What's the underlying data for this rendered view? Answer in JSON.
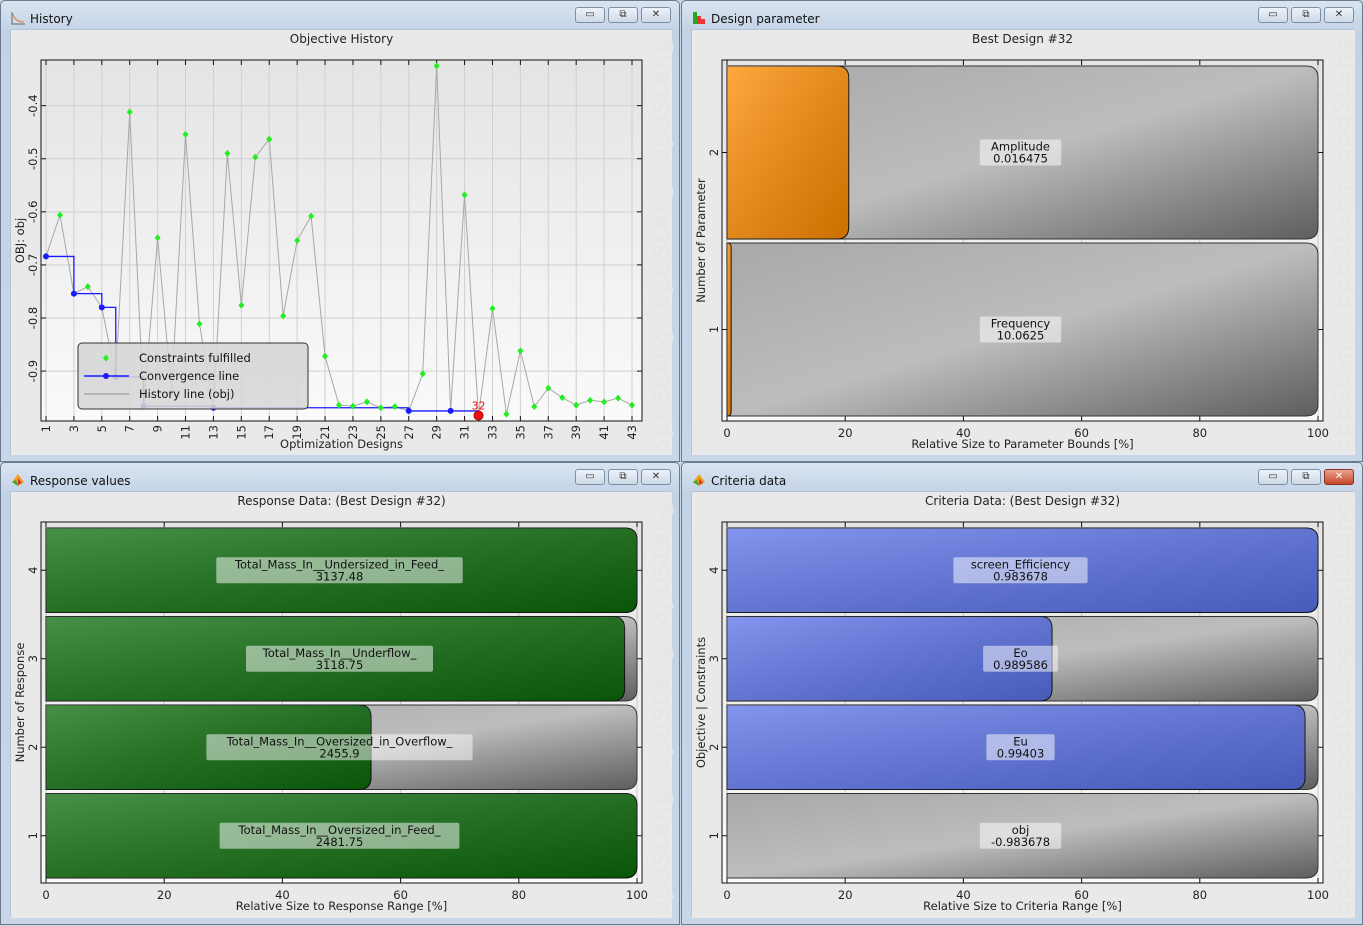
{
  "windows": {
    "history": {
      "title": "History",
      "icon": "history-chart-icon",
      "buttons": {
        "minimize": "▭",
        "restore": "⧉",
        "close": "✕"
      }
    },
    "design": {
      "title": "Design parameter",
      "icon": "bar-chart-icon",
      "buttons": {
        "minimize": "▭",
        "restore": "⧉",
        "close": "✕"
      }
    },
    "response": {
      "title": "Response values",
      "icon": "optislang-icon",
      "buttons": {
        "minimize": "▭",
        "restore": "⧉",
        "close": "✕"
      }
    },
    "criteria": {
      "title": "Criteria data",
      "icon": "optislang-icon",
      "buttons": {
        "minimize": "▭",
        "restore": "⧉",
        "close": "✕"
      }
    }
  },
  "watermark": "optiSLang",
  "chart_data": [
    {
      "type": "line",
      "title": "Objective History",
      "xlabel": "Optimization Designs",
      "ylabel": "OBJ: obj",
      "xlim": [
        0.6,
        43.6
      ],
      "ylim": [
        -0.994,
        -0.314
      ],
      "xticks": [
        1,
        3,
        5,
        7,
        9,
        11,
        13,
        15,
        17,
        19,
        21,
        23,
        25,
        27,
        29,
        31,
        33,
        35,
        37,
        39,
        41,
        43
      ],
      "yticks": [
        -0.4,
        -0.5,
        -0.6,
        -0.7,
        -0.8,
        -0.9
      ],
      "grid": true,
      "legend": {
        "placement": "bottom-left",
        "entries": [
          "Constraints fulfilled",
          "Convergence line",
          "History line (obj)"
        ]
      },
      "best_label": "32",
      "colors": {
        "history": "#a8a8a8",
        "feasible": "#22ee22",
        "convergence": "#1a1aff",
        "best": "#ee1111"
      },
      "series": [
        {
          "name": "History line (obj)",
          "x": [
            1,
            2,
            3,
            4,
            5,
            6,
            7,
            8,
            9,
            10,
            11,
            12,
            13,
            14,
            15,
            16,
            17,
            18,
            19,
            20,
            21,
            22,
            23,
            24,
            25,
            26,
            27,
            28,
            29,
            30,
            31,
            32,
            33,
            34,
            35,
            36,
            37,
            38,
            39,
            40,
            41,
            42,
            43
          ],
          "y": [
            -0.684,
            -0.606,
            -0.754,
            -0.741,
            -0.78,
            -0.911,
            -0.412,
            -0.966,
            -0.649,
            -0.94,
            -0.454,
            -0.811,
            -0.969,
            -0.49,
            -0.776,
            -0.497,
            -0.463,
            -0.796,
            -0.654,
            -0.608,
            -0.872,
            -0.964,
            -0.966,
            -0.958,
            -0.969,
            -0.967,
            -0.975,
            -0.905,
            -0.325,
            -0.975,
            -0.568,
            -0.983678,
            -0.782,
            -0.981,
            -0.862,
            -0.967,
            -0.932,
            -0.95,
            -0.964,
            -0.955,
            -0.958,
            -0.951,
            -0.964
          ]
        },
        {
          "name": "Convergence line",
          "x": [
            1,
            3,
            5,
            6,
            8,
            13,
            27,
            30,
            32
          ],
          "y": [
            -0.684,
            -0.754,
            -0.78,
            -0.911,
            -0.966,
            -0.969,
            -0.975,
            -0.975,
            -0.983678
          ]
        }
      ]
    },
    {
      "type": "bar",
      "orientation": "horizontal",
      "title": "Best Design #32",
      "xlabel": "Relative Size to Parameter Bounds [%]",
      "ylabel": "Number of Parameter",
      "xlim": [
        0,
        100
      ],
      "xticks": [
        0,
        20,
        40,
        60,
        80,
        100
      ],
      "categories": [
        "1",
        "2"
      ],
      "color": "#ff8c00",
      "bars": [
        {
          "name": "Frequency",
          "value_text": "10.0625",
          "percent": 0.7
        },
        {
          "name": "Amplitude",
          "value_text": "0.016475",
          "percent": 20.6
        }
      ]
    },
    {
      "type": "bar",
      "orientation": "horizontal",
      "title": "Response Data: (Best Design #32)",
      "xlabel": "Relative Size to Response Range [%]",
      "ylabel": "Number of Response",
      "xlim": [
        0,
        100
      ],
      "xticks": [
        0,
        20,
        40,
        60,
        80,
        100
      ],
      "categories": [
        "1",
        "2",
        "3",
        "4"
      ],
      "color": "#0b6b0b",
      "bars": [
        {
          "name": "Total_Mass_In__Oversized_in_Feed_",
          "value_text": "2481.75",
          "percent": 100
        },
        {
          "name": "Total_Mass_In__Oversized_in_Overflow_",
          "value_text": "2455.9",
          "percent": 55
        },
        {
          "name": "Total_Mass_In__Underflow_",
          "value_text": "3118.75",
          "percent": 97.9
        },
        {
          "name": "Total_Mass_In__Undersized_in_Feed_",
          "value_text": "3137.48",
          "percent": 100
        }
      ]
    },
    {
      "type": "bar",
      "orientation": "horizontal",
      "title": "Criteria Data: (Best Design #32)",
      "xlabel": "Relative Size to Criteria Range [%]",
      "ylabel": "Objective | Constraints",
      "xlim": [
        0,
        100
      ],
      "xticks": [
        0,
        20,
        40,
        60,
        80,
        100
      ],
      "categories": [
        "1",
        "2",
        "3",
        "4"
      ],
      "color": "#5a72e8",
      "bars": [
        {
          "name": "obj",
          "value_text": "-0.983678",
          "percent": 0
        },
        {
          "name": "Eu",
          "value_text": "0.99403",
          "percent": 97.8
        },
        {
          "name": "Eo",
          "value_text": "0.989586",
          "percent": 55
        },
        {
          "name": "screen_Efficiency",
          "value_text": "0.983678",
          "percent": 100
        }
      ]
    }
  ]
}
